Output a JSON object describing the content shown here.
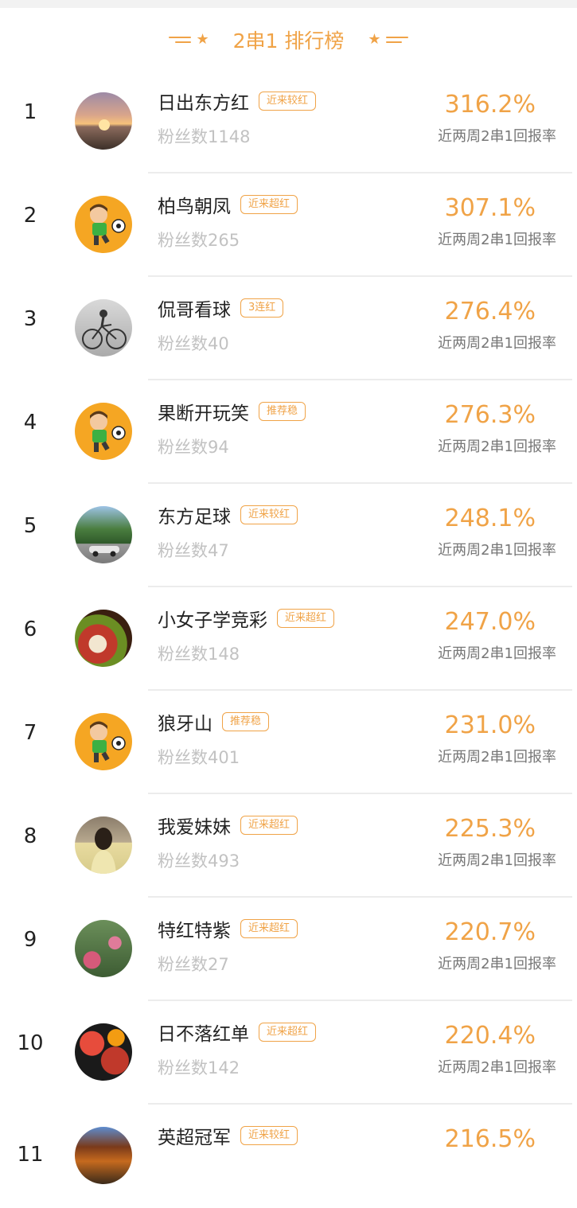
{
  "header": {
    "title": "2串1 排行榜"
  },
  "rate_label": "近两周2串1回报率",
  "rows": [
    {
      "rank": "1",
      "name": "日出东方红",
      "badge": "近来较红",
      "fans": "粉丝数1148",
      "rate": "316.2%",
      "avatar": "sunset-photo"
    },
    {
      "rank": "2",
      "name": "柏鸟朝凤",
      "badge": "近来超红",
      "fans": "粉丝数265",
      "rate": "307.1%",
      "avatar": "cartoon-footballer"
    },
    {
      "rank": "3",
      "name": "侃哥看球",
      "badge": "3连红",
      "fans": "粉丝数40",
      "rate": "276.4%",
      "avatar": "cyclist-photo"
    },
    {
      "rank": "4",
      "name": "果断开玩笑",
      "badge": "推荐稳",
      "fans": "粉丝数94",
      "rate": "276.3%",
      "avatar": "cartoon-footballer"
    },
    {
      "rank": "5",
      "name": "东方足球",
      "badge": "近来较红",
      "fans": "粉丝数47",
      "rate": "248.1%",
      "avatar": "tree-car-photo"
    },
    {
      "rank": "6",
      "name": "小女子学竞彩",
      "badge": "近来超红",
      "fans": "粉丝数148",
      "rate": "247.0%",
      "avatar": "food-photo"
    },
    {
      "rank": "7",
      "name": "狼牙山",
      "badge": "推荐稳",
      "fans": "粉丝数401",
      "rate": "231.0%",
      "avatar": "cartoon-footballer"
    },
    {
      "rank": "8",
      "name": "我爱妹妹",
      "badge": "近来超红",
      "fans": "粉丝数493",
      "rate": "225.3%",
      "avatar": "girl-photo"
    },
    {
      "rank": "9",
      "name": "特红特紫",
      "badge": "近来超红",
      "fans": "粉丝数27",
      "rate": "220.7%",
      "avatar": "flowers-photo"
    },
    {
      "rank": "10",
      "name": "日不落红单",
      "badge": "近来超红",
      "fans": "粉丝数142",
      "rate": "220.4%",
      "avatar": "fruit-photo"
    },
    {
      "rank": "11",
      "name": "英超冠军",
      "badge": "近来较红",
      "fans": "",
      "rate": "216.5%",
      "avatar": "football-player-photo"
    }
  ],
  "colors": {
    "accent": "#f0a347",
    "muted": "#c2c2c2",
    "divider": "#ececec"
  }
}
